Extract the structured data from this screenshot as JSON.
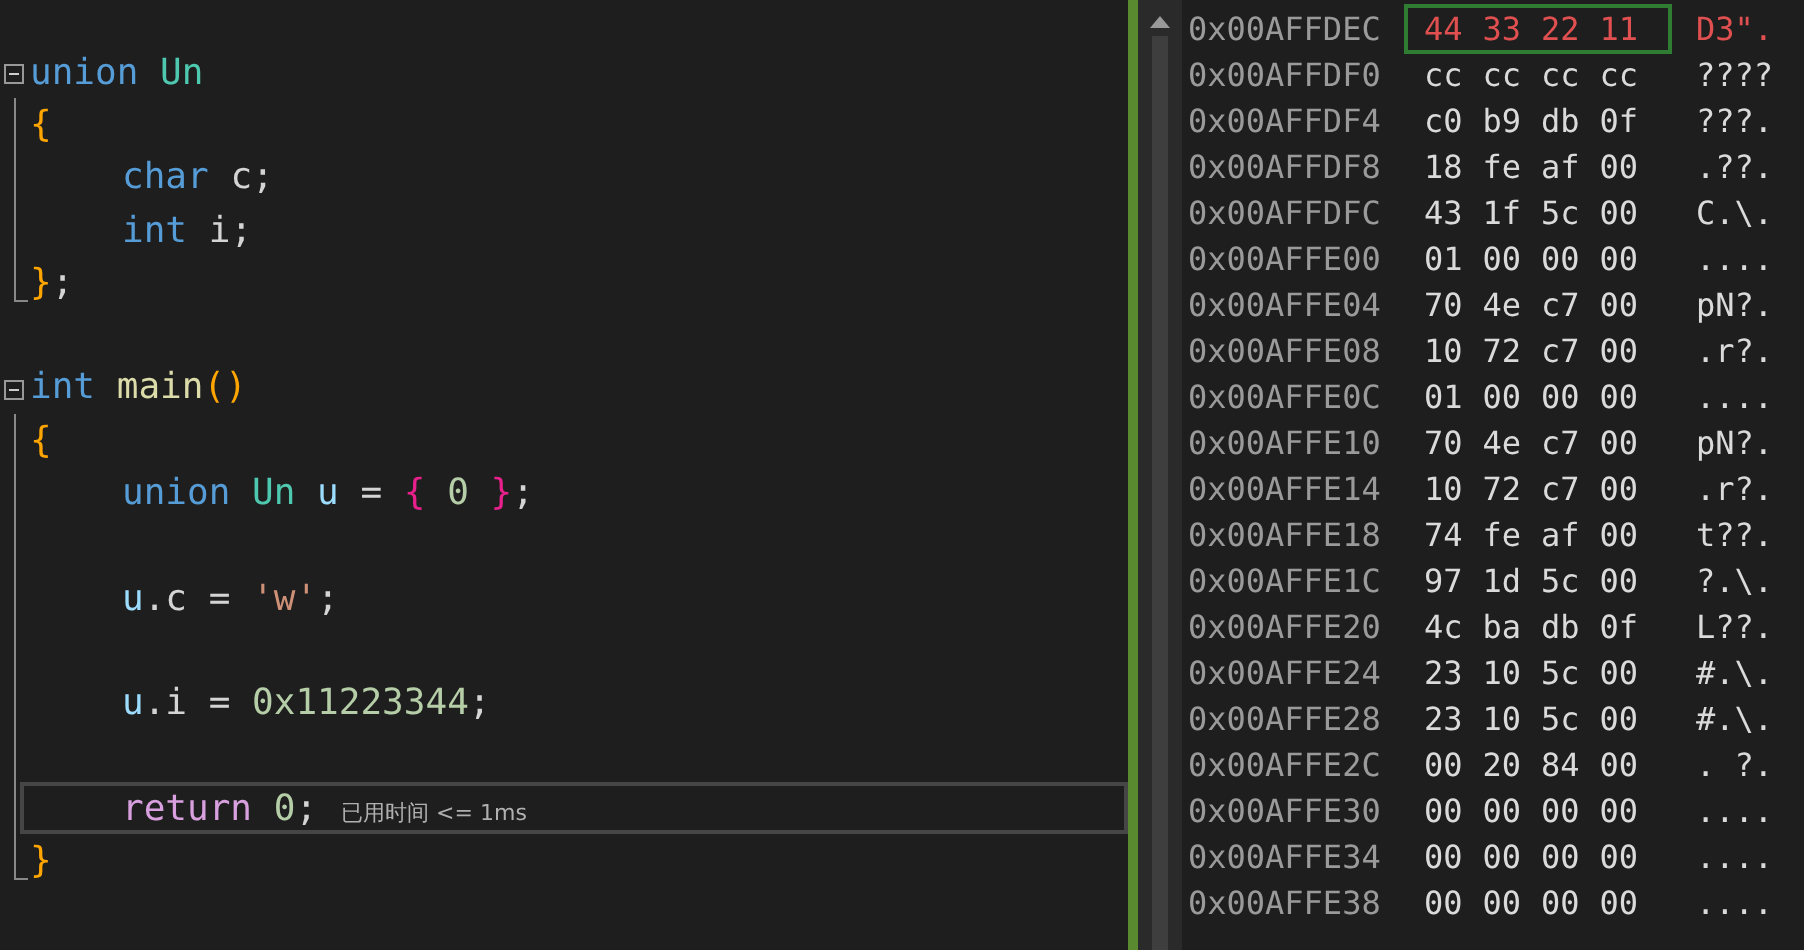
{
  "editor": {
    "lines": [
      {
        "collapsible": true,
        "current": false,
        "tokens": [
          {
            "text": "union ",
            "kind": "keyword"
          },
          {
            "text": "Un",
            "kind": "type"
          }
        ]
      },
      {
        "current": false,
        "tokens": [
          {
            "text": "{",
            "kind": "brace1"
          }
        ]
      },
      {
        "indented": true,
        "current": false,
        "tokens": [
          {
            "text": "char",
            "kind": "keyword"
          },
          {
            "text": " c;",
            "kind": "plain"
          }
        ]
      },
      {
        "indented": true,
        "current": false,
        "tokens": [
          {
            "text": "int",
            "kind": "keyword"
          },
          {
            "text": " i;",
            "kind": "plain"
          }
        ]
      },
      {
        "block_end": true,
        "current": false,
        "tokens": [
          {
            "text": "}",
            "kind": "brace1"
          },
          {
            "text": ";",
            "kind": "plain"
          }
        ]
      },
      {
        "current": false
      },
      {
        "collapsible": true,
        "current": false,
        "tokens": [
          {
            "text": "int ",
            "kind": "keyword"
          },
          {
            "text": "main",
            "kind": "func"
          },
          {
            "text": "()",
            "kind": "brace1"
          }
        ]
      },
      {
        "current": false,
        "tokens": [
          {
            "text": "{",
            "kind": "brace1"
          }
        ]
      },
      {
        "indented": true,
        "current": false,
        "tokens": [
          {
            "text": "union ",
            "kind": "keyword"
          },
          {
            "text": "Un",
            "kind": "type"
          },
          {
            "text": " u",
            "kind": "var"
          },
          {
            "text": " = ",
            "kind": "plain"
          },
          {
            "text": "{",
            "kind": "brace2"
          },
          {
            "text": " 0 ",
            "kind": "number"
          },
          {
            "text": "}",
            "kind": "brace2"
          },
          {
            "text": ";",
            "kind": "plain"
          }
        ]
      },
      {
        "current": false
      },
      {
        "indented": true,
        "current": false,
        "tokens": [
          {
            "text": "u",
            "kind": "var"
          },
          {
            "text": ".c = ",
            "kind": "plain"
          },
          {
            "text": "'w'",
            "kind": "string"
          },
          {
            "text": ";",
            "kind": "plain"
          }
        ]
      },
      {
        "current": false
      },
      {
        "indented": true,
        "current": false,
        "tokens": [
          {
            "text": "u",
            "kind": "var"
          },
          {
            "text": ".i = ",
            "kind": "plain"
          },
          {
            "text": "0x11223344",
            "kind": "number"
          },
          {
            "text": ";",
            "kind": "plain"
          }
        ]
      },
      {
        "current": false
      },
      {
        "indented": true,
        "current": true,
        "hint": "已用时间 <= 1ms",
        "tokens": [
          {
            "text": "return ",
            "kind": "control"
          },
          {
            "text": "0",
            "kind": "number"
          },
          {
            "text": ";",
            "kind": "plain"
          }
        ]
      },
      {
        "block_end": true,
        "current": false,
        "tokens": [
          {
            "text": "}",
            "kind": "brace1"
          }
        ]
      }
    ]
  },
  "memory": {
    "rows": [
      {
        "address": "0x00AFFDEC",
        "bytes": [
          "44",
          "33",
          "22",
          "11"
        ],
        "ascii": "D3\".",
        "changed": true
      },
      {
        "address": "0x00AFFDF0",
        "bytes": [
          "cc",
          "cc",
          "cc",
          "cc"
        ],
        "ascii": "????",
        "changed": false
      },
      {
        "address": "0x00AFFDF4",
        "bytes": [
          "c0",
          "b9",
          "db",
          "0f"
        ],
        "ascii": "???.",
        "changed": false
      },
      {
        "address": "0x00AFFDF8",
        "bytes": [
          "18",
          "fe",
          "af",
          "00"
        ],
        "ascii": ".??.",
        "changed": false
      },
      {
        "address": "0x00AFFDFC",
        "bytes": [
          "43",
          "1f",
          "5c",
          "00"
        ],
        "ascii": "C.\\.",
        "changed": false
      },
      {
        "address": "0x00AFFE00",
        "bytes": [
          "01",
          "00",
          "00",
          "00"
        ],
        "ascii": "....",
        "changed": false
      },
      {
        "address": "0x00AFFE04",
        "bytes": [
          "70",
          "4e",
          "c7",
          "00"
        ],
        "ascii": "pN?.",
        "changed": false
      },
      {
        "address": "0x00AFFE08",
        "bytes": [
          "10",
          "72",
          "c7",
          "00"
        ],
        "ascii": ".r?.",
        "changed": false
      },
      {
        "address": "0x00AFFE0C",
        "bytes": [
          "01",
          "00",
          "00",
          "00"
        ],
        "ascii": "....",
        "changed": false
      },
      {
        "address": "0x00AFFE10",
        "bytes": [
          "70",
          "4e",
          "c7",
          "00"
        ],
        "ascii": "pN?.",
        "changed": false
      },
      {
        "address": "0x00AFFE14",
        "bytes": [
          "10",
          "72",
          "c7",
          "00"
        ],
        "ascii": ".r?.",
        "changed": false
      },
      {
        "address": "0x00AFFE18",
        "bytes": [
          "74",
          "fe",
          "af",
          "00"
        ],
        "ascii": "t??.",
        "changed": false
      },
      {
        "address": "0x00AFFE1C",
        "bytes": [
          "97",
          "1d",
          "5c",
          "00"
        ],
        "ascii": "?.\\.",
        "changed": false
      },
      {
        "address": "0x00AFFE20",
        "bytes": [
          "4c",
          "ba",
          "db",
          "0f"
        ],
        "ascii": "L??.",
        "changed": false
      },
      {
        "address": "0x00AFFE24",
        "bytes": [
          "23",
          "10",
          "5c",
          "00"
        ],
        "ascii": "#.\\.",
        "changed": false
      },
      {
        "address": "0x00AFFE28",
        "bytes": [
          "23",
          "10",
          "5c",
          "00"
        ],
        "ascii": "#.\\.",
        "changed": false
      },
      {
        "address": "0x00AFFE2C",
        "bytes": [
          "00",
          "20",
          "84",
          "00"
        ],
        "ascii": ". ?.",
        "changed": false
      },
      {
        "address": "0x00AFFE30",
        "bytes": [
          "00",
          "00",
          "00",
          "00"
        ],
        "ascii": "....",
        "changed": false
      },
      {
        "address": "0x00AFFE34",
        "bytes": [
          "00",
          "00",
          "00",
          "00"
        ],
        "ascii": "....",
        "changed": false
      },
      {
        "address": "0x00AFFE38",
        "bytes": [
          "00",
          "00",
          "00",
          "00"
        ],
        "ascii": "....",
        "changed": false
      }
    ]
  }
}
